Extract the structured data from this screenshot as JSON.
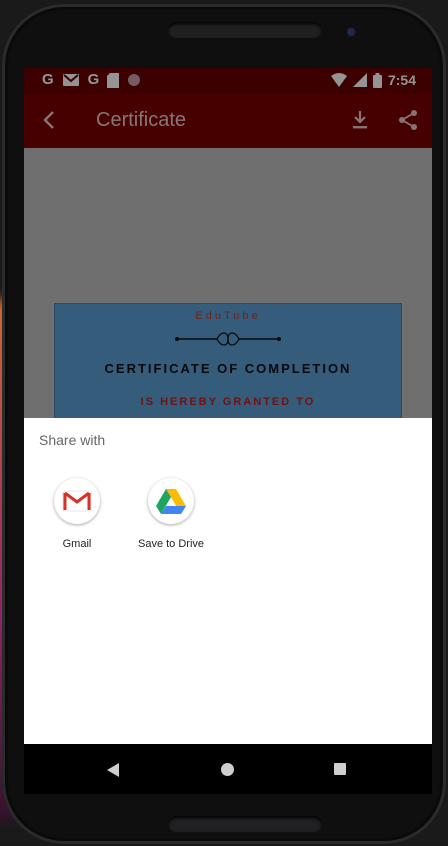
{
  "status_bar": {
    "left_icons": [
      "google-g-icon",
      "gmail-icon",
      "google-g-icon",
      "sd-card-icon",
      "record-dot-icon"
    ],
    "time": "7:54"
  },
  "toolbar": {
    "title": "Certificate",
    "back_icon": "arrow-back-icon",
    "download_icon": "download-icon",
    "share_icon": "share-icon"
  },
  "certificate": {
    "brand": "EduTube",
    "heading": "CERTIFICATE OF COMPLETION",
    "granted": "IS HEREBY GRANTED TO"
  },
  "share_sheet": {
    "heading": "Share with",
    "apps": [
      {
        "label": "Gmail",
        "icon": "gmail-icon"
      },
      {
        "label": "Save to Drive",
        "icon": "google-drive-icon"
      }
    ]
  },
  "nav_bar": [
    "nav-back-icon",
    "nav-home-icon",
    "nav-recents-icon"
  ],
  "colors": {
    "toolbar": "#7a0000",
    "status_bar": "#6a0000",
    "certificate_bg": "#5d9fd6"
  }
}
